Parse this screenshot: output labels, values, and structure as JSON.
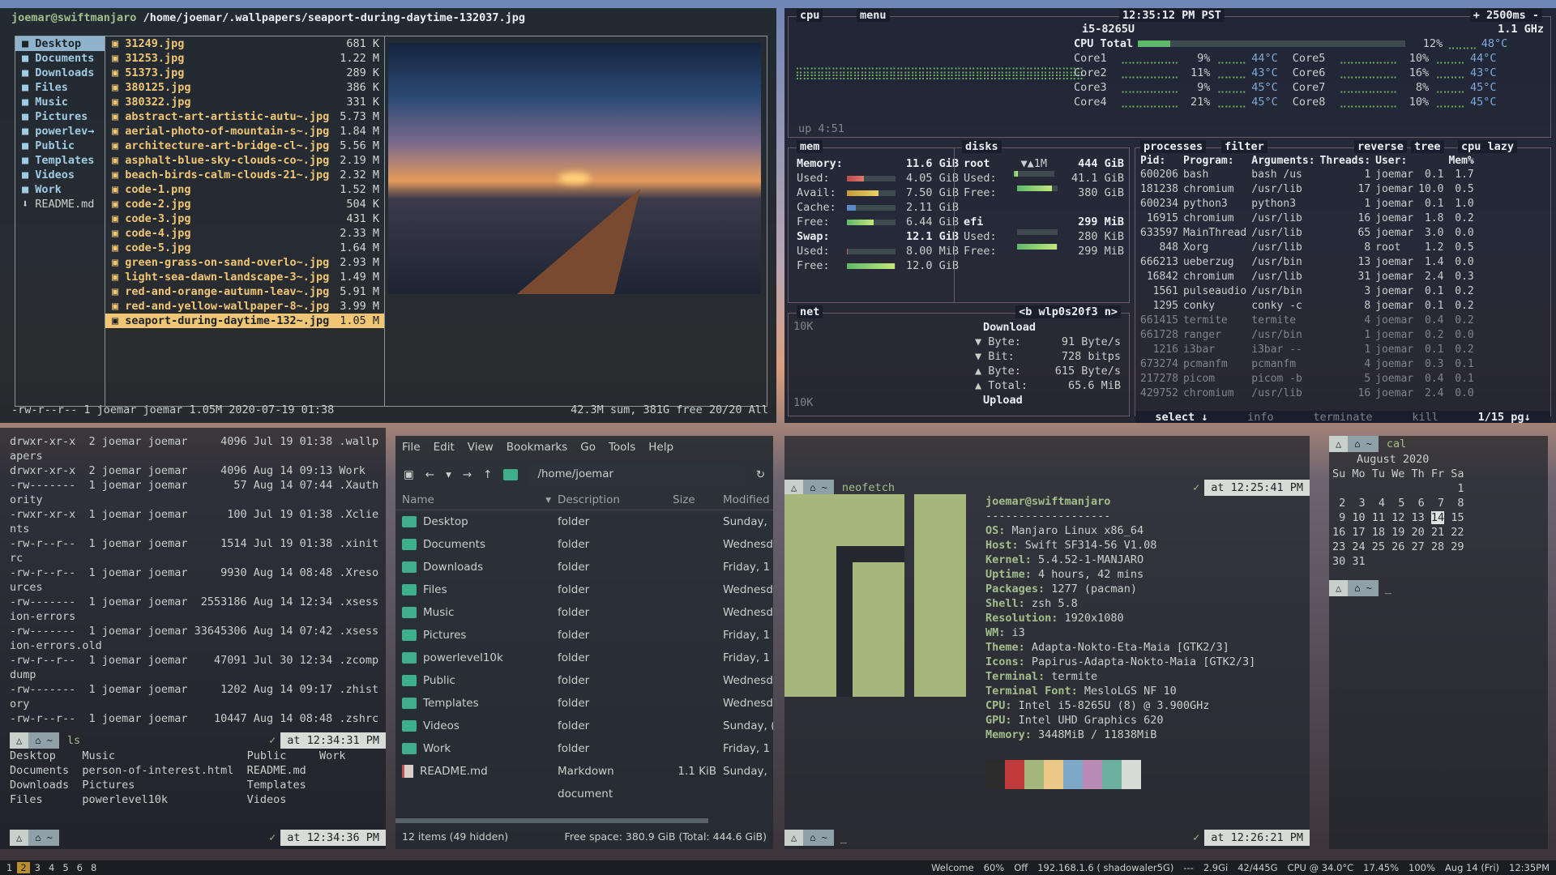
{
  "ranger": {
    "user_host": "joemar@swiftmanjaro",
    "path": "/home/joemar/.wallpapers/seaport-during-daytime-132037.jpg",
    "dirs": [
      "Desktop",
      "Documents",
      "Downloads",
      "Files",
      "Music",
      "Pictures",
      "powerlev→",
      "Public",
      "Templates",
      "Videos",
      "Work",
      "README.md"
    ],
    "files": [
      {
        "name": "31249.jpg",
        "size": "681 K"
      },
      {
        "name": "31253.jpg",
        "size": "1.22 M"
      },
      {
        "name": "51373.jpg",
        "size": "289 K"
      },
      {
        "name": "380125.jpg",
        "size": "386 K"
      },
      {
        "name": "380322.jpg",
        "size": "331 K"
      },
      {
        "name": "abstract-art-artistic-autu~.jpg",
        "size": "5.73 M"
      },
      {
        "name": "aerial-photo-of-mountain-s~.jpg",
        "size": "1.84 M"
      },
      {
        "name": "architecture-art-bridge-cl~.jpg",
        "size": "5.56 M"
      },
      {
        "name": "asphalt-blue-sky-clouds-co~.jpg",
        "size": "2.19 M"
      },
      {
        "name": "beach-birds-calm-clouds-21~.jpg",
        "size": "2.32 M"
      },
      {
        "name": "code-1.png",
        "size": "1.52 M"
      },
      {
        "name": "code-2.jpg",
        "size": "504 K"
      },
      {
        "name": "code-3.jpg",
        "size": "431 K"
      },
      {
        "name": "code-4.jpg",
        "size": "2.33 M"
      },
      {
        "name": "code-5.jpg",
        "size": "1.64 M"
      },
      {
        "name": "green-grass-on-sand-overlo~.jpg",
        "size": "2.93 M"
      },
      {
        "name": "light-sea-dawn-landscape-3~.jpg",
        "size": "1.49 M"
      },
      {
        "name": "red-and-orange-autumn-leav~.jpg",
        "size": "5.91 M"
      },
      {
        "name": "red-and-yellow-wallpaper-8~.jpg",
        "size": "3.99 M"
      },
      {
        "name": "seaport-during-daytime-132~.jpg",
        "size": "1.05 M"
      }
    ],
    "status_left": "-rw-r--r-- 1 joemar joemar 1.05M 2020-07-19 01:38",
    "status_right": "42.3M sum, 381G free  20/20  All"
  },
  "bpytop": {
    "cpu_label": "cpu",
    "menu_label": "menu",
    "clock": "12:35:12 PM PST",
    "interval": "+ 2500ms -",
    "cpu_model": "i5-8265U",
    "freq": "1.1 GHz",
    "cpu_total": {
      "label": "CPU Total",
      "pct": "12%",
      "temp": "48°C",
      "fill": 0.12
    },
    "cores_left": [
      {
        "name": "Core1",
        "pct": "9%",
        "temp": "44°C"
      },
      {
        "name": "Core2",
        "pct": "11%",
        "temp": "43°C"
      },
      {
        "name": "Core3",
        "pct": "9%",
        "temp": "45°C"
      },
      {
        "name": "Core4",
        "pct": "21%",
        "temp": "45°C"
      }
    ],
    "cores_right": [
      {
        "name": "Core5",
        "pct": "10%",
        "temp": "44°C"
      },
      {
        "name": "Core6",
        "pct": "16%",
        "temp": "43°C"
      },
      {
        "name": "Core7",
        "pct": "8%",
        "temp": "45°C"
      },
      {
        "name": "Core8",
        "pct": "10%",
        "temp": "45°C"
      }
    ],
    "uptime": "up 4:51",
    "mem": {
      "title": "mem",
      "rows": [
        {
          "k": "Memory:",
          "v": "11.6 GiB",
          "bold": true
        },
        {
          "k": "Used:",
          "v": "4.05 GiB",
          "meter": "red",
          "fill": 0.35
        },
        {
          "k": "Avail:",
          "v": "7.50 GiB",
          "meter": "yel",
          "fill": 0.65
        },
        {
          "k": "Cache:",
          "v": "2.11 GiB",
          "meter": "blue",
          "fill": 0.18
        },
        {
          "k": "Free:",
          "v": "6.44 GiB",
          "meter": "grn",
          "fill": 0.55
        },
        {
          "k": "Swap:",
          "v": "12.1 GiB",
          "bold": true
        },
        {
          "k": "Used:",
          "v": "8.00 MiB",
          "meter": "red",
          "fill": 0.01
        },
        {
          "k": "Free:",
          "v": "12.0 GiB",
          "meter": "grn",
          "fill": 0.99
        }
      ]
    },
    "disks": {
      "title": "disks",
      "root_label": "root",
      "root_io": "▼▲1M",
      "root_size": "444 GiB",
      "root_used": "41.1 GiB",
      "root_free": "380 GiB",
      "efi_label": "efi",
      "efi_size": "299 MiB",
      "efi_used": "280 KiB",
      "efi_free": "299 MiB",
      "used_label": "Used:",
      "free_label": "Free:"
    },
    "net": {
      "title": "net",
      "iface": "<b wlp0s20f3 n>",
      "download": "Download",
      "upload": "Upload",
      "rows": [
        {
          "k": "▼ Byte:",
          "v": "91 Byte/s"
        },
        {
          "k": "▼ Bit:",
          "v": "728 bitps"
        },
        {
          "k": "▲ Byte:",
          "v": "615 Byte/s"
        },
        {
          "k": "▲ Total:",
          "v": "65.6 MiB"
        }
      ],
      "scale_top": "10K",
      "scale_bottom": "10K"
    },
    "proc": {
      "title": "processes",
      "filter": "filter",
      "reverse": "reverse",
      "tree": "tree",
      "sort": "cpu lazy",
      "headers": [
        "Pid:",
        "Program:",
        "Arguments:",
        "Threads:",
        "User:",
        "Mem%"
      ],
      "rows": [
        [
          "600206",
          "bash",
          "bash /us",
          "1",
          "joemar",
          "0.1",
          "1.7"
        ],
        [
          "181238",
          "chromium",
          "/usr/lib",
          "17",
          "joemar",
          "10.0",
          "0.5"
        ],
        [
          "600234",
          "python3",
          "python3",
          "1",
          "joemar",
          "0.1",
          "1.0"
        ],
        [
          "16915",
          "chromium",
          "/usr/lib",
          "16",
          "joemar",
          "1.8",
          "0.2"
        ],
        [
          "633597",
          "MainThread",
          "/usr/lib",
          "65",
          "joemar",
          "3.0",
          "0.0"
        ],
        [
          "848",
          "Xorg",
          "/usr/lib",
          "8",
          "root",
          "1.2",
          "0.5"
        ],
        [
          "666213",
          "ueberzug",
          "/usr/bin",
          "13",
          "joemar",
          "1.4",
          "0.0"
        ],
        [
          "16842",
          "chromium",
          "/usr/lib",
          "31",
          "joemar",
          "2.4",
          "0.3"
        ],
        [
          "1561",
          "pulseaudio",
          "/usr/bin",
          "3",
          "joemar",
          "0.1",
          "0.2"
        ],
        [
          "1295",
          "conky",
          "conky -c",
          "8",
          "joemar",
          "0.1",
          "0.2"
        ],
        [
          "661415",
          "termite",
          "termite",
          "4",
          "joemar",
          "0.4",
          "0.2"
        ],
        [
          "661728",
          "ranger",
          "/usr/bin",
          "1",
          "joemar",
          "0.2",
          "0.0"
        ],
        [
          "1216",
          "i3bar",
          "i3bar --",
          "1",
          "joemar",
          "0.1",
          "0.2"
        ],
        [
          "673274",
          "pcmanfm",
          "pcmanfm",
          "4",
          "joemar",
          "0.3",
          "0.1"
        ],
        [
          "217278",
          "picom",
          "picom -b",
          "5",
          "joemar",
          "0.4",
          "0.1"
        ],
        [
          "429752",
          "chromium",
          "/usr/lib",
          "16",
          "joemar",
          "2.4",
          "0.0"
        ]
      ],
      "select": "select ↓",
      "info": "info",
      "terminate": "terminate",
      "kill": "kill",
      "pg": "1/15 pg↓"
    }
  },
  "term_left": {
    "ls_la": [
      "drwxr-xr-x  2 joemar joemar     4096 Jul 19 01:38 .wallp",
      "apers",
      "drwxr-xr-x  2 joemar joemar     4096 Aug 14 09:13 Work",
      "-rw-------  1 joemar joemar       57 Aug 14 07:44 .Xauth",
      "ority",
      "-rwxr-xr-x  1 joemar joemar      100 Jul 19 01:38 .Xclie",
      "nts",
      "-rw-r--r--  1 joemar joemar     1514 Jul 19 01:38 .xinit",
      "rc",
      "-rw-r--r--  1 joemar joemar     9930 Aug 14 08:48 .Xreso",
      "urces",
      "-rw-------  1 joemar joemar  2553186 Aug 14 12:34 .xsess",
      "ion-errors",
      "-rw-------  1 joemar joemar 33645306 Aug 14 07:42 .xsess",
      "ion-errors.old",
      "-rw-r--r--  1 joemar joemar    47091 Jul 30 12:34 .zcomp",
      "dump",
      "-rw-------  1 joemar joemar     1202 Aug 14 09:17 .zhist",
      "ory",
      "-rw-r--r--  1 joemar joemar    10447 Aug 14 08:48 .zshrc"
    ],
    "prompt1_cmd": "ls",
    "prompt1_time": "at 12:34:31 PM",
    "ls_out": [
      "Desktop    Music                    Public     Work",
      "Documents  person-of-interest.html  README.md",
      "Downloads  Pictures                 Templates",
      "Files      powerlevel10k            Videos"
    ],
    "prompt2_time": "at 12:34:36 PM"
  },
  "pcmanfm": {
    "menu": [
      "File",
      "Edit",
      "View",
      "Bookmarks",
      "Go",
      "Tools",
      "Help"
    ],
    "location": "/home/joemar",
    "columns": [
      "Name",
      "Description",
      "Size",
      "Modified"
    ],
    "rows": [
      {
        "name": "Desktop",
        "desc": "folder",
        "size": "",
        "mod": "Sunday,",
        "type": "folder"
      },
      {
        "name": "Documents",
        "desc": "folder",
        "size": "",
        "mod": "Wednesd",
        "type": "folder"
      },
      {
        "name": "Downloads",
        "desc": "folder",
        "size": "",
        "mod": "Friday, 1",
        "type": "folder"
      },
      {
        "name": "Files",
        "desc": "folder",
        "size": "",
        "mod": "Wednesd",
        "type": "folder"
      },
      {
        "name": "Music",
        "desc": "folder",
        "size": "",
        "mod": "Wednesd",
        "type": "folder"
      },
      {
        "name": "Pictures",
        "desc": "folder",
        "size": "",
        "mod": "Friday, 1",
        "type": "folder"
      },
      {
        "name": "powerlevel10k",
        "desc": "folder",
        "size": "",
        "mod": "Friday, 1",
        "type": "folder"
      },
      {
        "name": "Public",
        "desc": "folder",
        "size": "",
        "mod": "Wednesd",
        "type": "folder"
      },
      {
        "name": "Templates",
        "desc": "folder",
        "size": "",
        "mod": "Wednesd",
        "type": "folder"
      },
      {
        "name": "Videos",
        "desc": "folder",
        "size": "",
        "mod": "Sunday, (",
        "type": "folder"
      },
      {
        "name": "Work",
        "desc": "folder",
        "size": "",
        "mod": "Friday, 1",
        "type": "folder"
      },
      {
        "name": "README.md",
        "desc": "Markdown document",
        "size": "1.1 KiB",
        "mod": "Sunday,",
        "type": "doc"
      }
    ],
    "status_left": "12 items (49 hidden)",
    "status_right": "Free space: 380.9 GiB (Total: 444.6 GiB)"
  },
  "neofetch": {
    "cmd": "neofetch",
    "time": "at 12:25:41 PM",
    "title": "joemar@swiftmanjaro",
    "sep": "-------------------",
    "fields": [
      {
        "k": "OS",
        "v": "Manjaro Linux x86_64"
      },
      {
        "k": "Host",
        "v": "Swift SF314-56 V1.08"
      },
      {
        "k": "Kernel",
        "v": "5.4.52-1-MANJARO"
      },
      {
        "k": "Uptime",
        "v": "4 hours, 42 mins"
      },
      {
        "k": "Packages",
        "v": "1277 (pacman)"
      },
      {
        "k": "Shell",
        "v": "zsh 5.8"
      },
      {
        "k": "Resolution",
        "v": "1920x1080"
      },
      {
        "k": "WM",
        "v": "i3"
      },
      {
        "k": "Theme",
        "v": "Adapta-Nokto-Eta-Maia [GTK2/3]"
      },
      {
        "k": "Icons",
        "v": "Papirus-Adapta-Nokto-Maia [GTK2/3]"
      },
      {
        "k": "Terminal",
        "v": "termite"
      },
      {
        "k": "Terminal Font",
        "v": "MesloLGS NF 10"
      },
      {
        "k": "CPU",
        "v": "Intel i5-8265U (8) @ 3.900GHz"
      },
      {
        "k": "GPU",
        "v": "Intel UHD Graphics 620"
      },
      {
        "k": "Memory",
        "v": "3448MiB / 11838MiB"
      }
    ],
    "palette": [
      "#2b2b2b",
      "#c0393b",
      "#a5b77a",
      "#e8c884",
      "#7ea8c8",
      "#b98ab4",
      "#6cb0a0",
      "#d8dcd6"
    ],
    "time2": "at 12:26:21 PM",
    "prompt_cursor": "_"
  },
  "cal": {
    "cmd": "cal",
    "month": "August 2020",
    "days_header": "Su Mo Tu We Th Fr Sa",
    "weeks": [
      "                   1",
      " 2  3  4  5  6  7  8",
      " 9 10 11 12 13 14 15",
      "16 17 18 19 20 21 22",
      "23 24 25 26 27 28 29",
      "30 31"
    ],
    "today": "14",
    "prompt_cursor": "_"
  },
  "bar": {
    "workspaces": [
      "1",
      "2",
      "3",
      "4",
      "5",
      "6",
      "8"
    ],
    "active_ws": "2",
    "items": [
      "Welcome",
      "60%",
      "Off",
      "192.168.1.6 ( shadowaler5G)",
      "---",
      "2.9Gi",
      "42/445G",
      "CPU @ 34.0°C",
      "17.45%",
      "100%",
      "Aug 14 (Fri)",
      "12:35PM"
    ]
  },
  "colors": {
    "accent_green": "#a3be8c",
    "selection_yellow": "#f0c674",
    "manjaro_green": "#a5b77a",
    "ws_active": "#b99030"
  }
}
